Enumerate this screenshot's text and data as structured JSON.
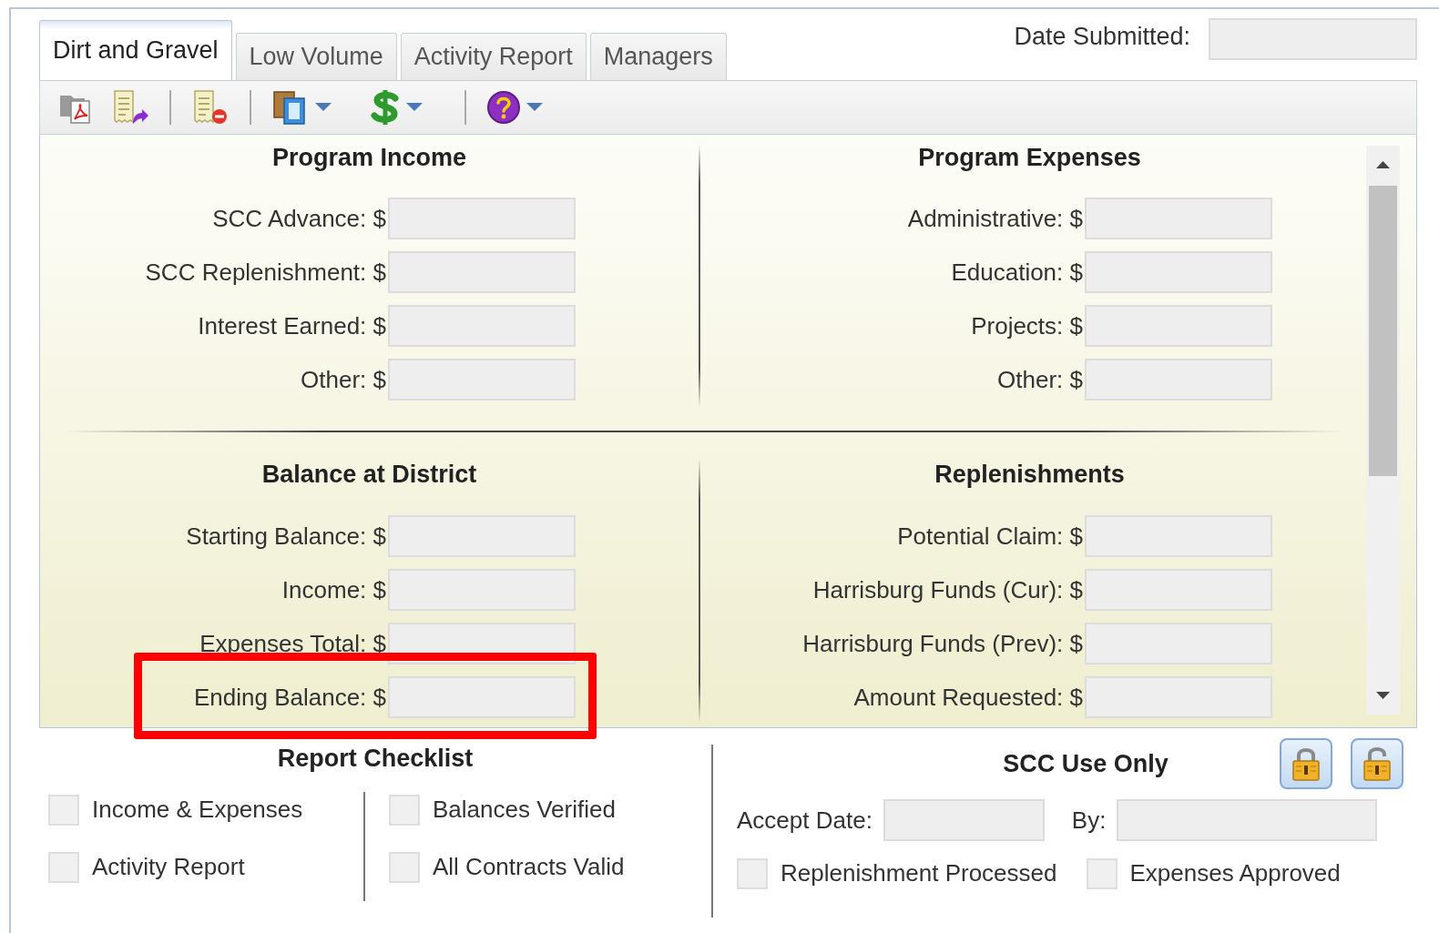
{
  "tabs": [
    {
      "label": "Dirt and Gravel",
      "selected": true
    },
    {
      "label": "Low Volume",
      "selected": false
    },
    {
      "label": "Activity Report",
      "selected": false
    },
    {
      "label": "Managers",
      "selected": false
    }
  ],
  "date_submitted": {
    "label": "Date Submitted:"
  },
  "sections": [
    {
      "title": "Program Income",
      "fields": [
        {
          "label": "SCC Advance: $",
          "highlighted": false
        },
        {
          "label": "SCC Replenishment: $",
          "highlighted": false
        },
        {
          "label": "Interest Earned: $",
          "highlighted": false
        },
        {
          "label": "Other: $",
          "highlighted": false
        }
      ]
    },
    {
      "title": "Program Expenses",
      "fields": [
        {
          "label": "Administrative: $",
          "highlighted": false
        },
        {
          "label": "Education: $",
          "highlighted": false
        },
        {
          "label": "Projects: $",
          "highlighted": false
        },
        {
          "label": "Other: $",
          "highlighted": false
        }
      ]
    },
    {
      "title": "Balance at District",
      "fields": [
        {
          "label": "Starting Balance: $",
          "highlighted": false
        },
        {
          "label": "Income: $",
          "highlighted": false
        },
        {
          "label": "Expenses Total: $",
          "highlighted": false
        },
        {
          "label": "Ending Balance: $",
          "highlighted": true
        }
      ]
    },
    {
      "title": "Replenishments",
      "fields": [
        {
          "label": "Potential Claim: $",
          "highlighted": false
        },
        {
          "label": "Harrisburg Funds (Cur): $",
          "highlighted": false
        },
        {
          "label": "Harrisburg Funds (Prev): $",
          "highlighted": false
        },
        {
          "label": "Amount Requested: $",
          "highlighted": false
        }
      ]
    }
  ],
  "report_checklist": {
    "title": "Report Checklist",
    "items": [
      {
        "label": "Income & Expenses",
        "checked": false
      },
      {
        "label": "Balances Verified",
        "checked": false
      },
      {
        "label": "Activity Report",
        "checked": false
      },
      {
        "label": "All Contracts Valid",
        "checked": false
      }
    ]
  },
  "scc_use_only": {
    "title": "SCC Use Only",
    "accept_date": {
      "label": "Accept Date:"
    },
    "by": {
      "label": "By:"
    },
    "items": [
      {
        "label": "Replenishment Processed",
        "checked": false
      },
      {
        "label": "Expenses Approved",
        "checked": false
      }
    ]
  }
}
